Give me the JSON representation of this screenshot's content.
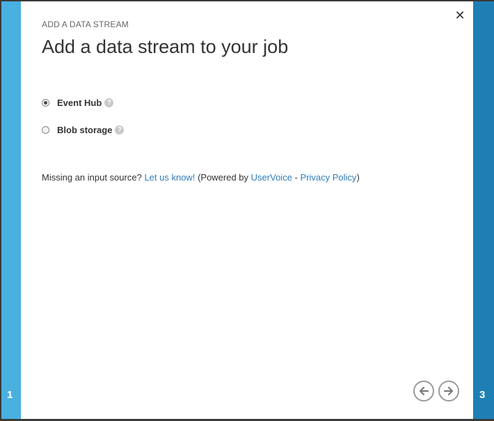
{
  "wizard": {
    "section_label": "ADD A DATA STREAM",
    "title": "Add a data stream to your job",
    "close_icon": "close-icon",
    "step_left": "1",
    "step_right": "3"
  },
  "options": [
    {
      "label": "Event Hub",
      "selected": true,
      "help_icon": "help-icon"
    },
    {
      "label": "Blob storage",
      "selected": false,
      "help_icon": "help-icon"
    }
  ],
  "footnote": {
    "prefix": "Missing an input source?",
    "link_feedback": "Let us know!",
    "powered_by": "(Powered by",
    "link_uservoice": "UserVoice",
    "separator": "-",
    "link_privacy": "Privacy Policy",
    "suffix": ")"
  },
  "navigation": {
    "prev_icon": "arrow-left-icon",
    "next_icon": "arrow-right-icon"
  },
  "colors": {
    "left_rail": "#48b1e0",
    "right_rail": "#1e7fb5",
    "link": "#2e7bb8"
  }
}
